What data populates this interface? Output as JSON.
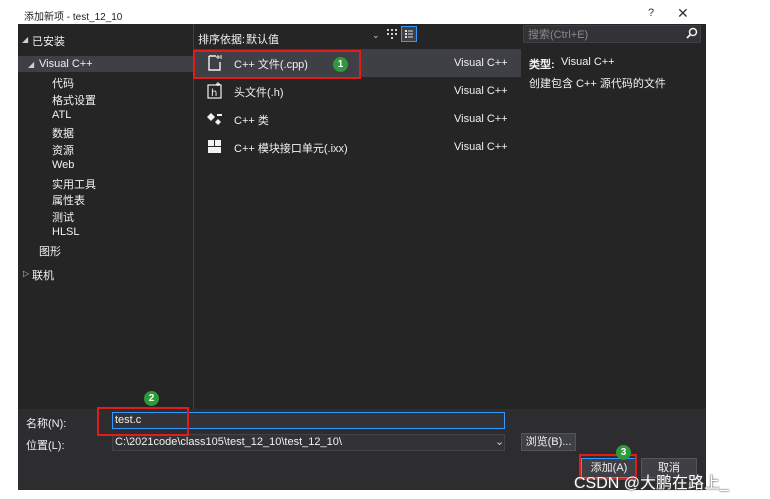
{
  "window": {
    "title": "添加新项 - test_12_10",
    "help": "?",
    "close": "✕"
  },
  "left_tree": {
    "installed": "已安装",
    "visual_cpp": "Visual C++",
    "children": [
      "代码",
      "格式设置",
      "ATL",
      "数据",
      "资源",
      "Web",
      "实用工具",
      "属性表",
      "测试",
      "HLSL"
    ],
    "graphics": "图形",
    "online": "联机"
  },
  "toolbar": {
    "sort_label": "排序依据:",
    "sort_value": "默认值",
    "search_placeholder": "搜索(Ctrl+E)"
  },
  "templates": [
    {
      "name": "C++ 文件(.cpp)",
      "lang": "Visual C++"
    },
    {
      "name": "头文件(.h)",
      "lang": "Visual C++"
    },
    {
      "name": "C++ 类",
      "lang": "Visual C++"
    },
    {
      "name": "C++ 模块接口单元(.ixx)",
      "lang": "Visual C++"
    }
  ],
  "details": {
    "type_label": "类型:",
    "type_value": "Visual C++",
    "description": "创建包含 C++ 源代码的文件"
  },
  "form": {
    "name_label": "名称(N):",
    "name_value": "test.c",
    "location_label": "位置(L):",
    "location_value": "C:\\2021code\\class105\\test_12_10\\test_12_10\\",
    "browse": "浏览(B)...",
    "add": "添加(A)",
    "cancel": "取消"
  },
  "annotations": [
    "1",
    "2",
    "3"
  ],
  "watermark": "CSDN @大鹏在路上_",
  "colors": {
    "background": "#2d2d30",
    "selection": "#3f3f46",
    "accent": "#3399ff",
    "annotation_red": "#e21b1b",
    "annotation_green": "#2f9a3c"
  }
}
